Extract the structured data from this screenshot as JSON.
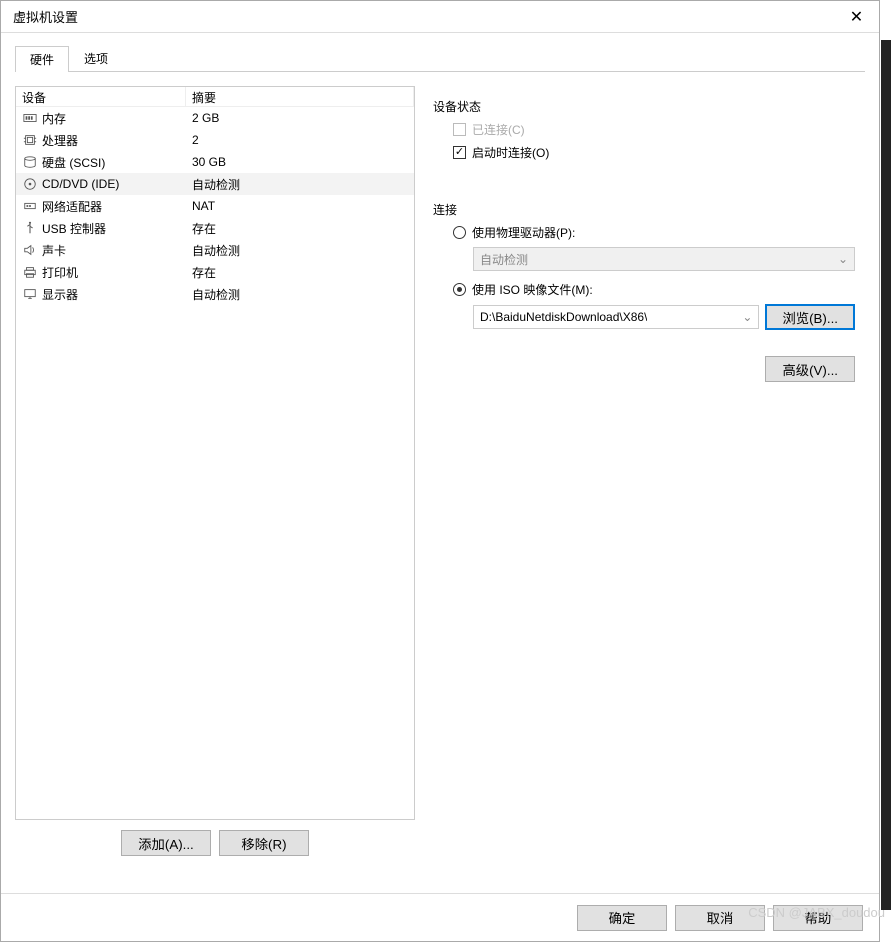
{
  "title": "虚拟机设置",
  "tabs": {
    "hardware": "硬件",
    "options": "选项"
  },
  "device_table": {
    "header_device": "设备",
    "header_summary": "摘要",
    "rows": [
      {
        "icon": "memory",
        "name": "内存",
        "summary": "2 GB"
      },
      {
        "icon": "cpu",
        "name": "处理器",
        "summary": "2"
      },
      {
        "icon": "disk",
        "name": "硬盘 (SCSI)",
        "summary": "30 GB"
      },
      {
        "icon": "cd",
        "name": "CD/DVD (IDE)",
        "summary": "自动检测"
      },
      {
        "icon": "network",
        "name": "网络适配器",
        "summary": "NAT"
      },
      {
        "icon": "usb",
        "name": "USB 控制器",
        "summary": "存在"
      },
      {
        "icon": "sound",
        "name": "声卡",
        "summary": "自动检测"
      },
      {
        "icon": "printer",
        "name": "打印机",
        "summary": "存在"
      },
      {
        "icon": "display",
        "name": "显示器",
        "summary": "自动检测"
      }
    ]
  },
  "buttons": {
    "add": "添加(A)...",
    "remove": "移除(R)",
    "browse": "浏览(B)...",
    "advanced": "高级(V)...",
    "ok": "确定",
    "cancel": "取消",
    "help": "帮助"
  },
  "status": {
    "legend": "设备状态",
    "connected": "已连接(C)",
    "connect_at_power_on": "启动时连接(O)"
  },
  "connection": {
    "legend": "连接",
    "physical": "使用物理驱动器(P):",
    "auto_detect": "自动检测",
    "iso": "使用 ISO 映像文件(M):",
    "iso_path": "D:\\BaiduNetdiskDownload\\X86\\"
  },
  "watermark": "CSDN @JABX_doudou"
}
